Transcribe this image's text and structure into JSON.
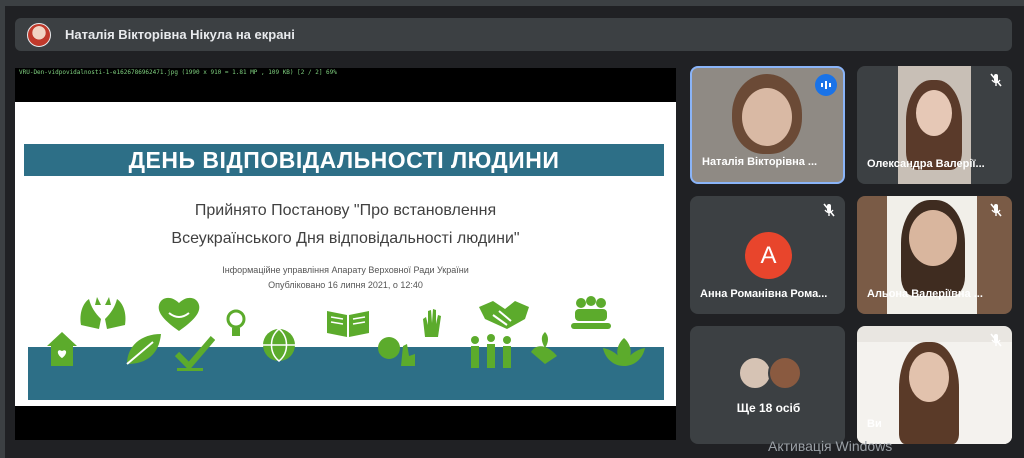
{
  "banner": {
    "title": "Наталія Вікторівна Нікула на екрані"
  },
  "share": {
    "caption": "VRU-Den-vidpovidalnosti-1-e1626786962471.jpg (1990 x 910 = 1.81 MP , 109 KB) [2 / 2]  69%",
    "slide": {
      "title": "ДЕНЬ ВІДПОВІДАЛЬНОСТІ ЛЮДИНИ",
      "headline_line1": "Прийнято Постанову \"Про встановлення",
      "headline_line2": "Всеукраїнського Дня відповідальності людини\"",
      "source": "Інформаційне управління Апарату Верховної Ради України",
      "published": "Опубліковано 16 липня 2021, о 12:40"
    }
  },
  "participants": [
    {
      "name": "Наталія Вікторівна ...",
      "muted": false,
      "speaking": true
    },
    {
      "name": "Олександра Валерії...",
      "muted": true
    },
    {
      "name": "Анна Романівна Рома...",
      "muted": true,
      "initial": "А"
    },
    {
      "name": "Альона Валеріївна ...",
      "muted": true
    },
    {
      "name": "Ви",
      "muted": true
    }
  ],
  "more": {
    "label": "Ще 18 осіб"
  },
  "watermark": "Активація Windows",
  "colors": {
    "background": "#202124",
    "tile": "#3c4043",
    "slide_band": "#2d6f87",
    "icon_green": "#5cab2c",
    "speaking_accent": "#1a73e8",
    "avatar_a": "#e8452c"
  }
}
